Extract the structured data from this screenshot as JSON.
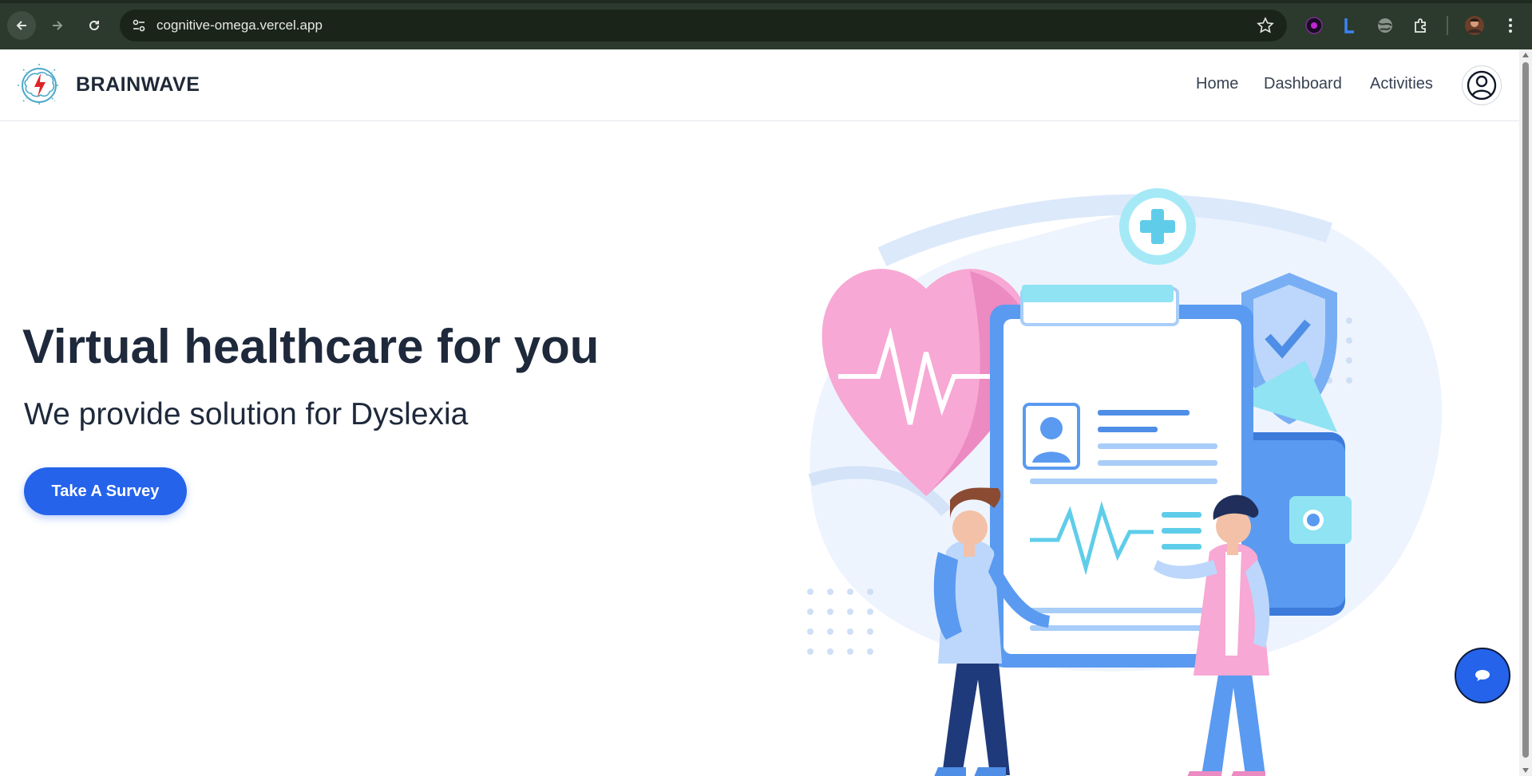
{
  "browser": {
    "url": "cognitive-omega.vercel.app",
    "icons": [
      "back-arrow-icon",
      "forward-arrow-icon",
      "reload-icon",
      "site-info-icon",
      "star-icon",
      "extension-icons",
      "puzzle-icon",
      "profile-icon",
      "menu-kebab-icon"
    ]
  },
  "navbar": {
    "brand": "BRAINWAVE",
    "links": [
      {
        "label": "Home"
      },
      {
        "label": "Dashboard"
      },
      {
        "label": "Activities"
      }
    ]
  },
  "hero": {
    "title": "Virtual healthcare for you",
    "subtitle": "We provide solution for Dyslexia",
    "cta_label": "Take A Survey"
  },
  "colors": {
    "accent": "#2563eb",
    "text": "#1e293b",
    "chrome_bg": "#2b3a2c"
  }
}
